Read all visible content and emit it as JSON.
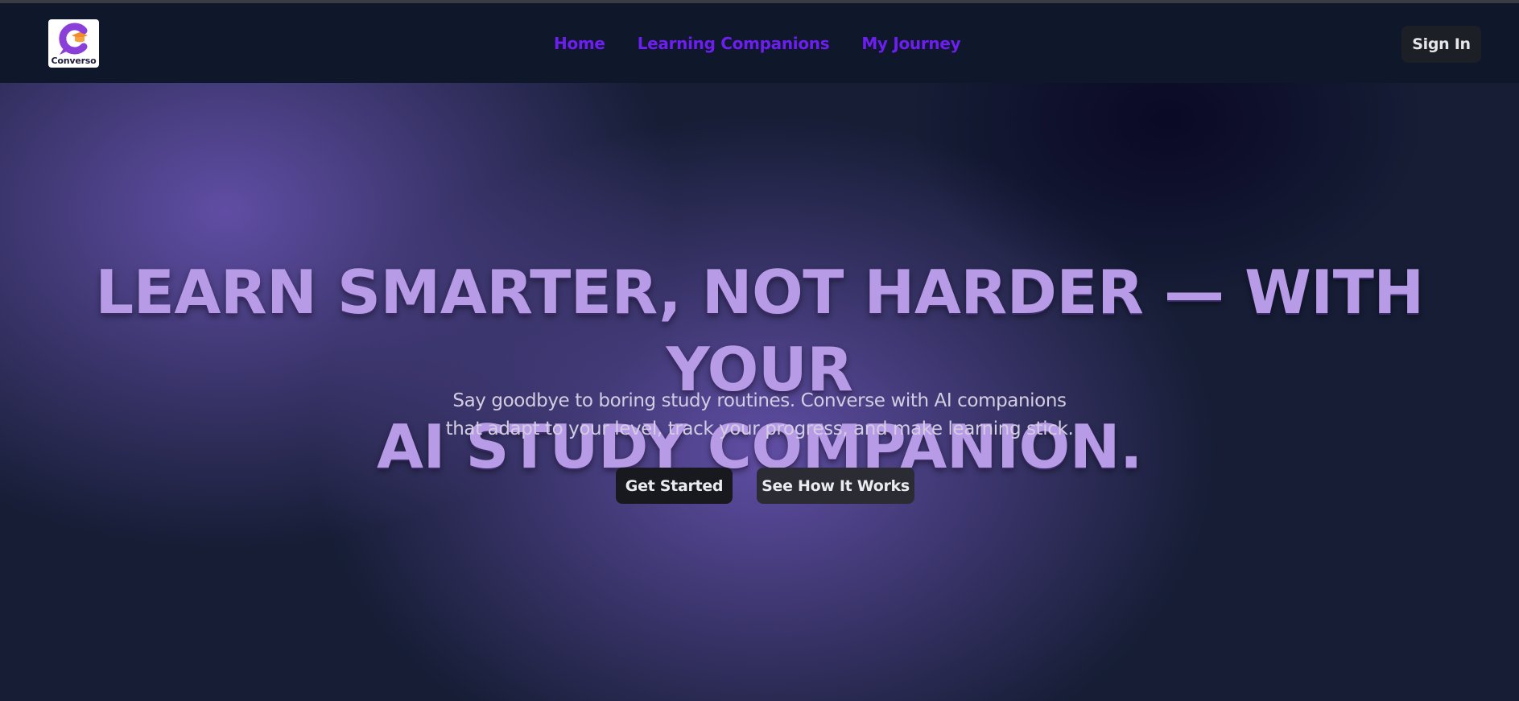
{
  "brand": {
    "name": "Converso",
    "accent": "#7c3aed"
  },
  "nav": {
    "links": [
      "Home",
      "Learning Companions",
      "My Journey"
    ],
    "sign_in_label": "Sign In"
  },
  "hero": {
    "headline_line1": "LEARN SMARTER, NOT HARDER — WITH YOUR",
    "headline_line2": "AI STUDY COMPANION.",
    "subtitle_line1": "Say goodbye to boring study routines. Converse with AI companions",
    "subtitle_line2": "that adapt to your level, track your progress, and make learning stick.",
    "primary_cta": "Get Started",
    "secondary_cta": "See How It Works"
  },
  "colors": {
    "nav_link": "#6d1ef0",
    "headline": "#b89be6",
    "background": "#0f172a"
  }
}
